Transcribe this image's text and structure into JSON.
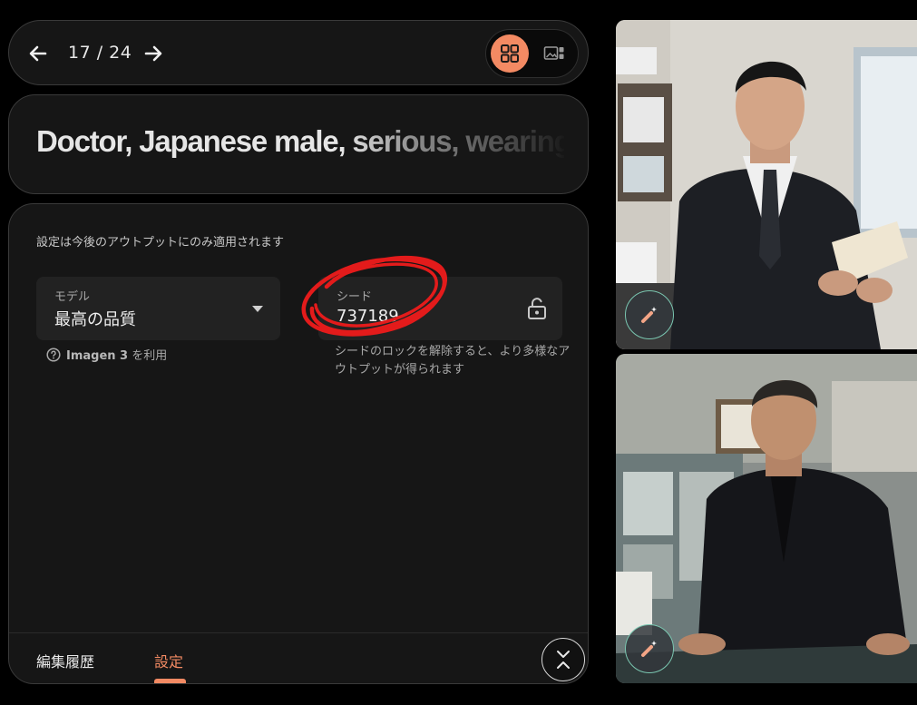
{
  "nav": {
    "page_counter": "17 / 24",
    "prev_icon": "arrow-left-icon",
    "next_icon": "arrow-right-icon",
    "grid_view_icon": "grid-icon",
    "single_view_icon": "image-layout-icon"
  },
  "prompt": {
    "text": "Doctor, Japanese male, serious, wearing"
  },
  "settings": {
    "notice": "設定は今後のアウトプットにのみ適用されます",
    "model": {
      "label": "モデル",
      "value": "最高の品質",
      "hint_icon": "help-circle-icon",
      "hint_strong": "Imagen 3",
      "hint_suffix": " を利用"
    },
    "seed": {
      "label": "シード",
      "value": "737189",
      "lock_icon": "unlock-icon",
      "hint": "シードのロックを解除すると、より多様なアウトプットが得られます"
    }
  },
  "tabs": [
    {
      "label": "編集履歴",
      "active": false
    },
    {
      "label": "設定",
      "active": true
    }
  ],
  "collapse_icon": "collapse-chevrons-icon",
  "images": [
    {
      "edit_icon": "magic-wand-icon"
    },
    {
      "edit_icon": "magic-wand-icon"
    }
  ],
  "colors": {
    "accent": "#f38a63",
    "annotation": "#e31b1b",
    "edit_border": "#7ac6b0"
  }
}
